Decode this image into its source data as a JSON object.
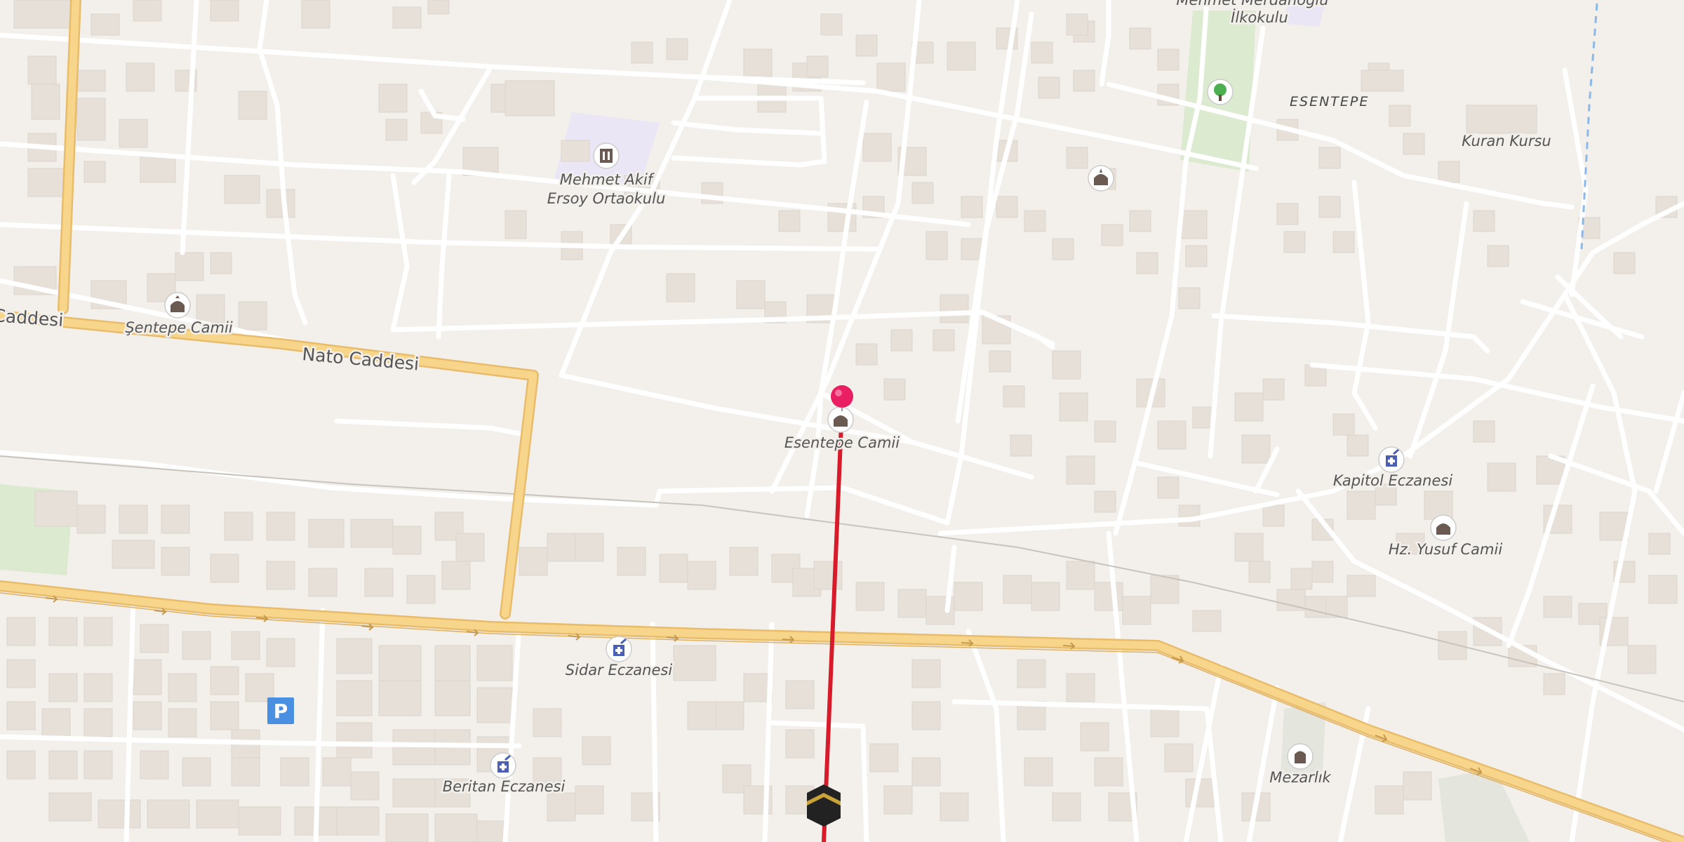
{
  "map": {
    "streets": [
      {
        "name": "Nato Caddesi"
      },
      {
        "name": "Caddesi"
      }
    ],
    "neighborhoods": [
      {
        "name": "ESENTEPE"
      }
    ],
    "pois": [
      {
        "name": "Mehmet Akif",
        "name2": "Ersoy Ortaokulu",
        "icon": "school-icon"
      },
      {
        "name": "Şentepe Camii",
        "icon": "mosque-icon"
      },
      {
        "name": "Esentepe Camii",
        "icon": "mosque-icon"
      },
      {
        "name": "Kapitol Eczanesi",
        "icon": "pharmacy-icon"
      },
      {
        "name": "Hz. Yusuf Camii",
        "icon": "mosque-icon"
      },
      {
        "name": "Sidar Eczanesi",
        "icon": "pharmacy-icon"
      },
      {
        "name": "Beritan Eczanesi",
        "icon": "pharmacy-icon"
      },
      {
        "name": "Mezarlık",
        "icon": "cemetery-icon"
      },
      {
        "name": "Kuran Kursu",
        "icon": null
      },
      {
        "name": "Mehmet Merdanoğlu",
        "name2": "İlkokulu",
        "icon": "school-icon"
      }
    ],
    "unlabeled_icons": [
      "park-icon",
      "mosque-icon",
      "parking-icon",
      "kaaba-icon"
    ],
    "route": {
      "color": "#d81b2a"
    },
    "colors": {
      "background": "#f3f0ec",
      "building": "#e6e0d8",
      "minor_road": "#ffffff",
      "main_road": "#f7d58a",
      "park": "#dcead0",
      "route": "#d81b2a",
      "pin": "#e91e63"
    }
  }
}
